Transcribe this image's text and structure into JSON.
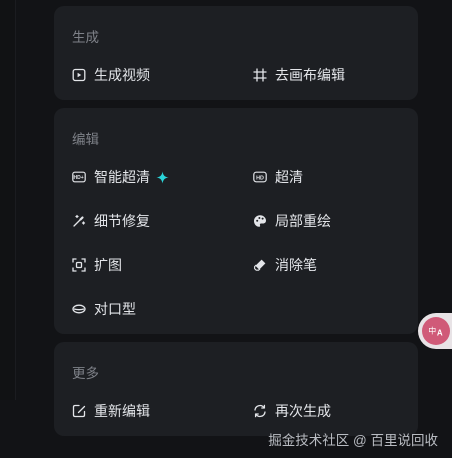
{
  "sections": {
    "generate": {
      "title": "生成",
      "items": {
        "generate_video": {
          "label": "生成视频",
          "icon": "play-icon"
        },
        "outpaint_edit": {
          "label": "去画布编辑",
          "icon": "crop-icon"
        }
      }
    },
    "edit": {
      "title": "编辑",
      "items": {
        "smart_hd": {
          "label": "智能超清",
          "icon": "hd-plus-icon",
          "badge_icon": "sparkle-icon"
        },
        "hd": {
          "label": "超清",
          "icon": "hd-icon"
        },
        "detail_fix": {
          "label": "细节修复",
          "icon": "magic-wand-icon"
        },
        "local_redraw": {
          "label": "局部重绘",
          "icon": "palette-icon"
        },
        "expand": {
          "label": "扩图",
          "icon": "expand-icon"
        },
        "eraser": {
          "label": "消除笔",
          "icon": "eraser-icon"
        },
        "lip_sync": {
          "label": "对口型",
          "icon": "lips-icon"
        }
      }
    },
    "more": {
      "title": "更多",
      "items": {
        "re_edit": {
          "label": "重新编辑",
          "icon": "edit-icon"
        },
        "regenerate": {
          "label": "再次生成",
          "icon": "refresh-icon"
        }
      }
    }
  },
  "floating_button": {
    "icon": "translate-icon"
  },
  "watermark": "掘金技术社区 @ 百里说回收",
  "colors": {
    "background": "#121316",
    "card": "#1d1f23",
    "text": "#e3e5e9",
    "section_title": "#7e8188",
    "accent_sparkle": "#2ad4d9",
    "float_pink": "#d05a78"
  }
}
